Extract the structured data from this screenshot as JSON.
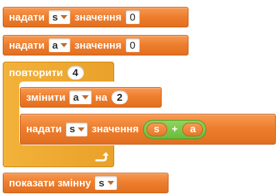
{
  "script": {
    "set_s": {
      "label": "надати",
      "variable": "s",
      "value_label": "значення",
      "value": "0"
    },
    "set_a": {
      "label": "надати",
      "variable": "a",
      "value_label": "значення",
      "value": "0"
    },
    "repeat": {
      "label": "повторити",
      "times": "4",
      "change_a": {
        "label": "змінити",
        "variable": "a",
        "by_label": "на",
        "amount": "2"
      },
      "set_s_sum": {
        "label": "надати",
        "variable": "s",
        "value_label": "значення",
        "sum": {
          "left": "s",
          "operator": "+",
          "right": "a"
        }
      },
      "loop_icon": "loop-arrow-icon"
    },
    "show_variable": {
      "label": "показати змінну",
      "variable": "s"
    }
  },
  "colors": {
    "variables_block": "#ee7f2f",
    "control_block": "#e9a12a",
    "operators_block": "#6cbc3c"
  }
}
